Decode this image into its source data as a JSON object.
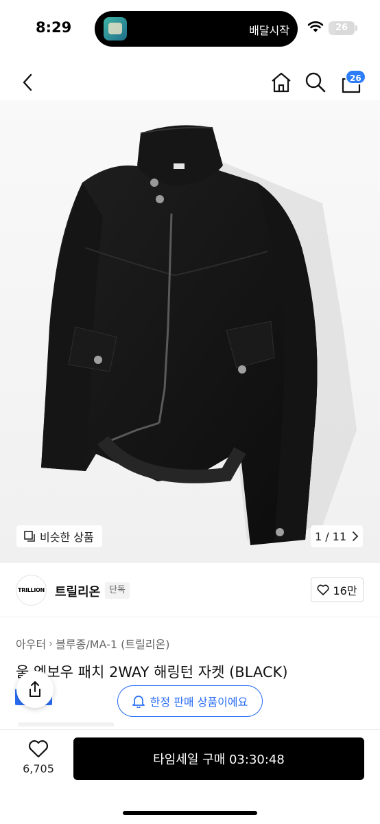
{
  "status_bar": {
    "time": "8:29",
    "island_text": "배달시작",
    "battery": "26"
  },
  "nav": {
    "cart_badge": "26"
  },
  "gallery": {
    "similar_label": "비슷한 상품",
    "page_counter": "1 / 11"
  },
  "brand": {
    "logo_text": "TRILLION",
    "name": "트릴리온",
    "tag": "단독",
    "like_count": "16만"
  },
  "breadcrumb": [
    "아우터",
    "블루종/MA-1 (트릴리온)"
  ],
  "product": {
    "title": "울 엠보우 패치 2WAY 해링턴 자켓 (BLACK)"
  },
  "limited_notice": "한정 판매 상품이에요",
  "bottom_bar": {
    "wish_count": "6,705",
    "buy_label": "타임세일 구매 03:30:48"
  },
  "colors": {
    "accent_blue": "#2a6df4",
    "badge_blue": "#2d7df6",
    "buy_button": "#000000"
  },
  "icons": {
    "back": "chevron-left-icon",
    "home": "home-icon",
    "search": "search-icon",
    "cart": "shopping-bag-icon",
    "similar": "copy-icon",
    "counter": "chevron-right-icon",
    "like": "heart-icon",
    "share": "share-icon",
    "bell": "bell-icon",
    "wish": "heart-icon"
  }
}
